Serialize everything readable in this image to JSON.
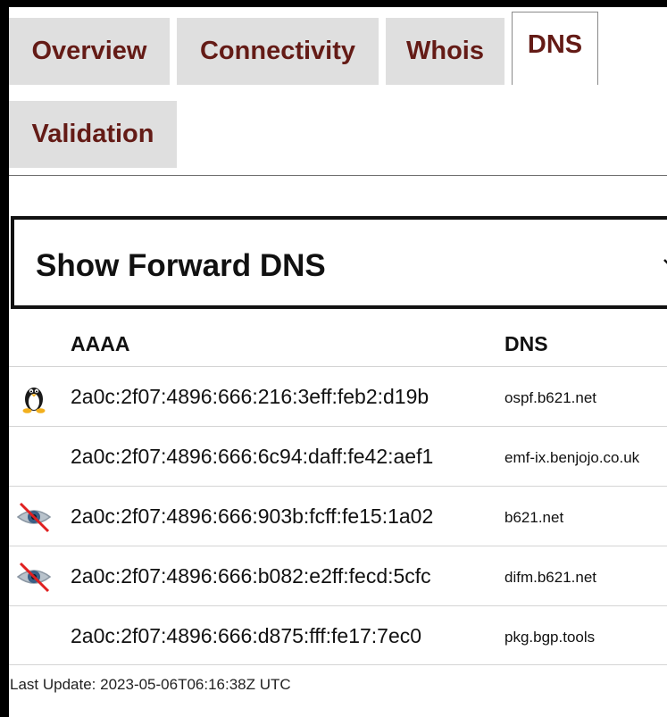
{
  "tabs": [
    {
      "label": "Overview"
    },
    {
      "label": "Connectivity"
    },
    {
      "label": "Whois"
    },
    {
      "label": "DNS",
      "active": true
    },
    {
      "label": "Validation"
    }
  ],
  "dns_select": {
    "selected": "Show Forward DNS",
    "icon": "chevron-down-icon"
  },
  "table": {
    "headers": [
      "AAAA",
      "DNS"
    ],
    "rows": [
      {
        "icon": "linux-penguin-icon",
        "ip": "2a0c:2f07:4896:666:216:3eff:feb2:d19b",
        "dns": "ospf.b621.net"
      },
      {
        "icon": "",
        "ip": "2a0c:2f07:4896:666:6c94:daff:fe42:aef1",
        "dns": "emf-ix.benjojo.co.uk"
      },
      {
        "icon": "eye-slashed-icon",
        "ip": "2a0c:2f07:4896:666:903b:fcff:fe15:1a02",
        "dns": "b621.net"
      },
      {
        "icon": "eye-slashed-icon",
        "ip": "2a0c:2f07:4896:666:b082:e2ff:fecd:5cfc",
        "dns": "difm.b621.net"
      },
      {
        "icon": "",
        "ip": "2a0c:2f07:4896:666:d875:fff:fe17:7ec0",
        "dns": "pkg.bgp.tools"
      }
    ]
  },
  "footer": {
    "last_update": "Last Update: 2023-05-06T06:16:38Z UTC"
  },
  "colors": {
    "tab_text": "#641b16",
    "tab_bg": "#dfdfdf",
    "frame": "#000000"
  }
}
